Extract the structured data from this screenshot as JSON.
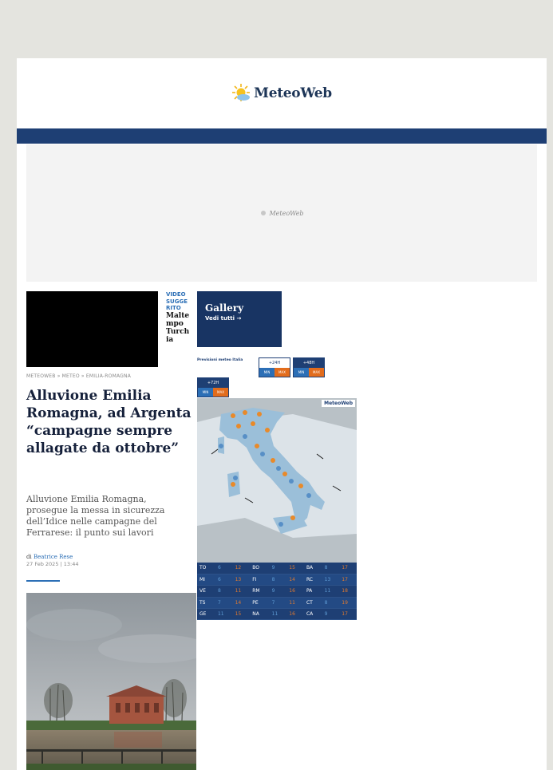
{
  "site": {
    "logo_text": "MeteoWeb",
    "ad_logo_text": "MeteoWeb"
  },
  "video": {
    "suggested_label": "VIDEO SUGGERITO",
    "title": "Maltempo Turchia"
  },
  "breadcrumb": "METEOWEB » METEO » EMILIA-ROMAGNA",
  "article": {
    "headline": "Alluvione Emilia Romagna, ad Argenta “campagne sempre allagate da ottobre”",
    "subheadline": "Alluvione Emilia Romagna, prosegue la messa in sicurezza dell’Idice nelle campagne del Ferrarese: il punto sui lavori",
    "author_prefix": "di",
    "author": "Beatrice Rese",
    "date": "27 Feb 2025 | 13:44"
  },
  "gallery": {
    "title": "Gallery",
    "link": "Vedi tutti →"
  },
  "forecast": {
    "label": "Previsioni meteo Italia",
    "tabs": [
      {
        "top": "+24H",
        "min": "MIN",
        "max": "MAX",
        "active": false
      },
      {
        "top": "+48H",
        "min": "MIN",
        "max": "MAX",
        "active": true
      },
      {
        "top": "+72H",
        "min": "MIN",
        "max": "MAX",
        "active": true
      }
    ],
    "map_logo": "MeteoWeb",
    "cities": [
      [
        [
          "TO",
          "6",
          "12"
        ],
        [
          "BO",
          "9",
          "15"
        ],
        [
          "BA",
          "8",
          "17"
        ]
      ],
      [
        [
          "MI",
          "6",
          "13"
        ],
        [
          "FI",
          "8",
          "14"
        ],
        [
          "RC",
          "13",
          "17"
        ]
      ],
      [
        [
          "VE",
          "8",
          "11"
        ],
        [
          "RM",
          "9",
          "16"
        ],
        [
          "PA",
          "11",
          "18"
        ]
      ],
      [
        [
          "TS",
          "7",
          "14"
        ],
        [
          "PE",
          "7",
          "11"
        ],
        [
          "CT",
          "8",
          "19"
        ]
      ],
      [
        [
          "GE",
          "11",
          "15"
        ],
        [
          "NA",
          "11",
          "16"
        ],
        [
          "CA",
          "9",
          "17"
        ]
      ]
    ]
  },
  "colors": {
    "navy": "#1e3f74",
    "accent_blue": "#2c6fb6",
    "accent_orange": "#e26c1c"
  }
}
